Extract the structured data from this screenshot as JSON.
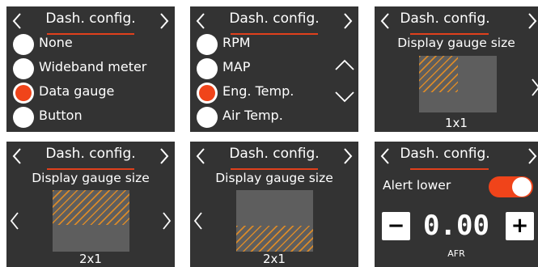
{
  "colors": {
    "panel_bg": "#333333",
    "accent": "#f0441a",
    "hatch": "#d98a2a",
    "gauge_bg": "#5e5e5e"
  },
  "screens": [
    {
      "title": "Dash. config.",
      "options": [
        {
          "label": "None",
          "selected": false
        },
        {
          "label": "Wideband meter",
          "selected": false
        },
        {
          "label": "Data gauge",
          "selected": true
        },
        {
          "label": "Button",
          "selected": false
        }
      ]
    },
    {
      "title": "Dash. config.",
      "options": [
        {
          "label": "RPM",
          "selected": false
        },
        {
          "label": "MAP",
          "selected": false
        },
        {
          "label": "Eng. Temp.",
          "selected": true
        },
        {
          "label": "Air Temp.",
          "selected": false
        }
      ],
      "scroll_up_icon": "chevron-up-icon",
      "scroll_down_icon": "chevron-down-icon"
    },
    {
      "title": "Dash. config.",
      "subtitle": "Display gauge size",
      "size_label": "1x1"
    },
    {
      "title": "Dash. config.",
      "subtitle": "Display gauge size",
      "size_label": "2x1"
    },
    {
      "title": "Dash. config.",
      "subtitle": "Display gauge size",
      "size_label": "2x1"
    },
    {
      "title": "Dash. config.",
      "alert_label": "Alert lower",
      "toggle_on": true,
      "minus_label": "−",
      "plus_label": "+",
      "value": "0.00",
      "unit": "AFR"
    }
  ]
}
